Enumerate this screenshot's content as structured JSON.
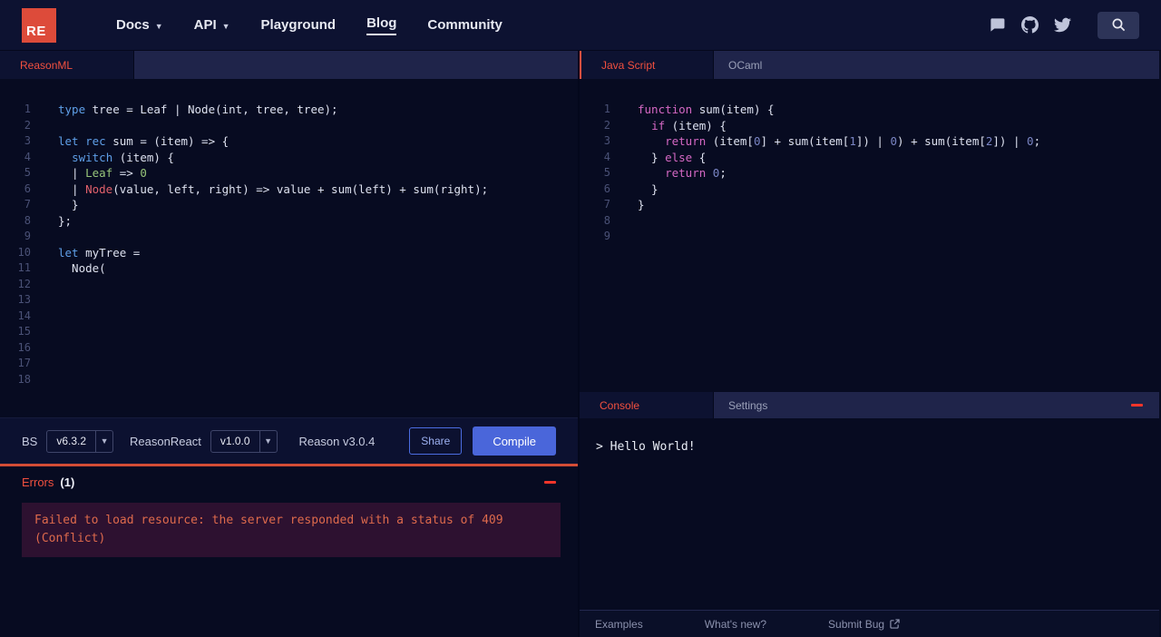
{
  "navbar": {
    "logo": "RE",
    "items": [
      {
        "label": "Docs",
        "caret": true
      },
      {
        "label": "API",
        "caret": true
      },
      {
        "label": "Playground",
        "caret": false
      },
      {
        "label": "Blog",
        "caret": false,
        "active": true
      },
      {
        "label": "Community",
        "caret": false
      }
    ],
    "icons": [
      "chat-icon",
      "github-icon",
      "twitter-icon",
      "search-icon"
    ]
  },
  "left": {
    "tab": "ReasonML",
    "editor": {
      "total_lines": 18,
      "lines": [
        [
          [
            "type",
            "b"
          ],
          [
            " tree = Leaf | Node(int, tree, tree);",
            "d"
          ]
        ],
        [],
        [
          [
            "let rec",
            "b"
          ],
          [
            " sum = (item) => {",
            "d"
          ]
        ],
        [
          [
            "  ",
            "d"
          ],
          [
            "switch",
            "b"
          ],
          [
            " (item) {",
            "d"
          ]
        ],
        [
          [
            "  | ",
            "d"
          ],
          [
            "Leaf",
            "g"
          ],
          [
            " => ",
            "d"
          ],
          [
            "0",
            "g"
          ]
        ],
        [
          [
            "  | ",
            "d"
          ],
          [
            "Node",
            "r"
          ],
          [
            "(value, left, right) => value + sum(left) + sum(right);",
            "d"
          ]
        ],
        [
          [
            "  }",
            "d"
          ]
        ],
        [
          [
            "};",
            "d"
          ]
        ],
        [],
        [
          [
            "let",
            "b"
          ],
          [
            " myTree =",
            "d"
          ]
        ],
        [
          [
            "  Node(",
            "d"
          ]
        ]
      ]
    },
    "toolbar": {
      "bs_label": "BS",
      "bs_version": "v6.3.2",
      "reasonreact_label": "ReasonReact",
      "reasonreact_version": "v1.0.0",
      "reason_version": "Reason v3.0.4",
      "share": "Share",
      "compile": "Compile"
    },
    "errors": {
      "title": "Errors",
      "count": "(1)",
      "message": "Failed to load resource: the server responded with a status of 409 (Conflict)"
    }
  },
  "right": {
    "tabs": [
      {
        "label": "Java Script",
        "active": true
      },
      {
        "label": "OCaml",
        "active": false
      }
    ],
    "editor": {
      "total_lines": 9,
      "lines": [
        [
          [
            "function",
            "m"
          ],
          [
            " sum(item) {",
            "d"
          ]
        ],
        [
          [
            "  ",
            "d"
          ],
          [
            "if",
            "m"
          ],
          [
            " (item) {",
            "d"
          ]
        ],
        [
          [
            "    ",
            "d"
          ],
          [
            "return",
            "m"
          ],
          [
            " (item[",
            "d"
          ],
          [
            "0",
            "n"
          ],
          [
            "] + sum(item[",
            "d"
          ],
          [
            "1",
            "n"
          ],
          [
            "]) | ",
            "d"
          ],
          [
            "0",
            "n"
          ],
          [
            ") + sum(item[",
            "d"
          ],
          [
            "2",
            "n"
          ],
          [
            "]) | ",
            "d"
          ],
          [
            "0",
            "n"
          ],
          [
            ";",
            "d"
          ]
        ],
        [
          [
            "  } ",
            "d"
          ],
          [
            "else",
            "m"
          ],
          [
            " {",
            "d"
          ]
        ],
        [
          [
            "    ",
            "d"
          ],
          [
            "return",
            "m"
          ],
          [
            " ",
            "d"
          ],
          [
            "0",
            "n"
          ],
          [
            ";",
            "d"
          ]
        ],
        [
          [
            "  }",
            "d"
          ]
        ],
        [
          [
            "}",
            "d"
          ]
        ]
      ]
    },
    "console": {
      "tabs": [
        {
          "label": "Console",
          "active": true
        },
        {
          "label": "Settings",
          "active": false
        }
      ],
      "output": "> Hello World!"
    },
    "footer": [
      "Examples",
      "What's new?",
      "Submit Bug"
    ]
  },
  "colors": {
    "accent": "#f2503f",
    "accent_bright": "#f5352a",
    "error_text": "#de6a4c",
    "error_bg": "#2d1130",
    "button_blue": "#4a66da",
    "logo_red": "#dd4b3a",
    "divider_orange": "#d44d36"
  }
}
